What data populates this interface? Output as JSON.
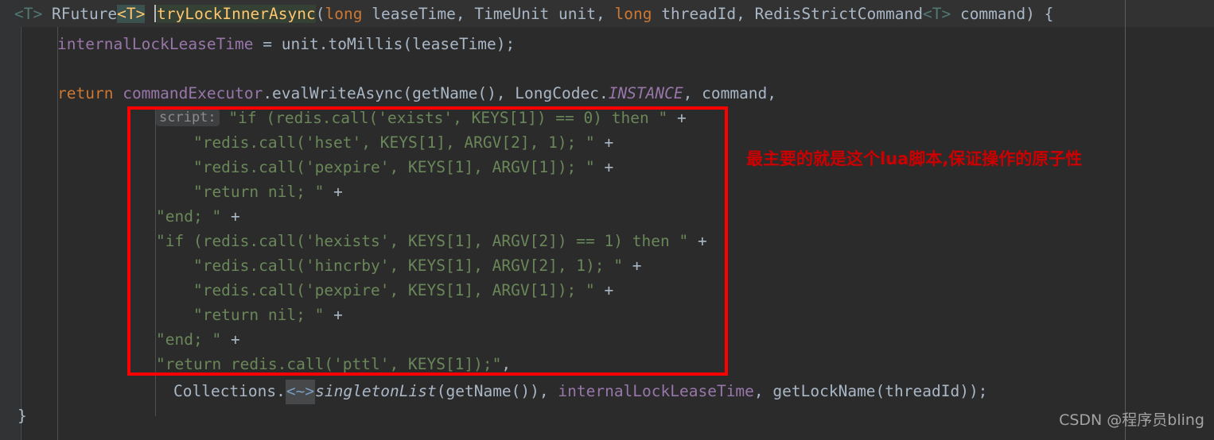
{
  "editor": {
    "theme_name": "darcula",
    "background": "#2b2b2b",
    "gutter_background": "#313335",
    "current_line_background": "#323232",
    "indent_guide_color": "#4d5052",
    "margin_guide_color": "#5a5d5f",
    "caret_color": "#bbbbbb"
  },
  "colors": {
    "keyword": "#cc7832",
    "string": "#6a8759",
    "field": "#9876aa",
    "default_text": "#a9b7c6",
    "type_param": "#4eade5",
    "brace_match_bg": "#3b514d",
    "identifier_highlight_bg": "#344134",
    "annotation_red": "#ff0000",
    "note_red": "#cc0000",
    "watermark": "#a3a3a3"
  },
  "code": {
    "signature_line": {
      "type_param_open": "<T>",
      "return_type": "RFuture",
      "generic_arg": "<T>",
      "method_name": "tryLockInnerAsync",
      "paren_open": "(",
      "param1_type": "long",
      "param1_name": "leaseTime,",
      "param2_type": "TimeUnit",
      "param2_name": "unit,",
      "param3_type": "long",
      "param3_name": "threadId,",
      "param4_type": "RedisStrictCommand",
      "param4_generic": "<T>",
      "param4_name": "command)",
      "brace_open": "{"
    },
    "assign_line": {
      "field": "internalLockLeaseTime",
      "rest": " = unit.toMillis(leaseTime);"
    },
    "return_line": {
      "keyword": "return",
      "receiver": "commandExecutor",
      "dot_method": ".evalWriteAsync(getName(), LongCodec.",
      "static_field": "INSTANCE",
      "tail": ", command,"
    },
    "inlay_hint": "script:",
    "lua_lines": [
      "\"if (redis.call('exists', KEYS[1]) == 0) then \"",
      "    \"redis.call('hset', KEYS[1], ARGV[2], 1); \"",
      "    \"redis.call('pexpire', KEYS[1], ARGV[1]); \"",
      "    \"return nil; \"",
      "\"end; \"",
      "\"if (redis.call('hexists', KEYS[1], ARGV[2]) == 1) then \"",
      "    \"redis.call('hincrby', KEYS[1], ARGV[2], 1); \"",
      "    \"redis.call('pexpire', KEYS[1], ARGV[1]); \"",
      "    \"return nil; \"",
      "\"end; \"",
      "\"return redis.call('pttl', KEYS[1]);\""
    ],
    "lua_plus": "+",
    "last_arg_line": {
      "prefix": "Collections.",
      "folded_generic": "<~>",
      "method": "singletonList",
      "mid": "(getName()), ",
      "field": "internalLockLeaseTime",
      "comma": ", ",
      "call": "getLockName",
      "tail": "(threadId));"
    },
    "closing_brace": "}"
  },
  "annotation": {
    "note_text": "最主要的就是这个lua脚本,保证操作的原子性",
    "box_label": "lua-script-highlight-box"
  },
  "watermark": {
    "text": "CSDN @程序员bling"
  }
}
